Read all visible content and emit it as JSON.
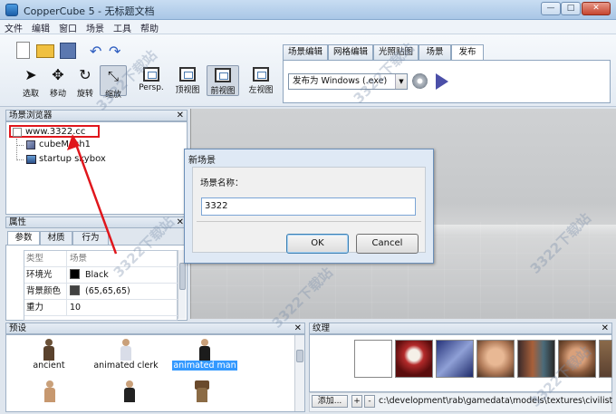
{
  "window": {
    "title": "CopperCube 5 - 无标题文档",
    "min": "—",
    "max": "□",
    "close": "✕"
  },
  "menu": [
    "文件",
    "编辑",
    "窗口",
    "场景",
    "工具",
    "帮助"
  ],
  "toolbar": {
    "tools": [
      {
        "id": "select",
        "label": "选取"
      },
      {
        "id": "move",
        "label": "移动"
      },
      {
        "id": "rotate",
        "label": "旋转"
      },
      {
        "id": "scale",
        "label": "缩放"
      },
      {
        "id": "persp",
        "label": "Persp."
      },
      {
        "id": "top",
        "label": "顶视图"
      },
      {
        "id": "front",
        "label": "前视图"
      },
      {
        "id": "left",
        "label": "左视图"
      }
    ],
    "tabs": [
      "场景编辑",
      "网格编辑",
      "光照贴图",
      "场景",
      "发布"
    ],
    "publish_select": "发布为 Windows (.exe)"
  },
  "scene_browser": {
    "title": "场景浏览器",
    "items": [
      {
        "label": "www.3322.cc"
      },
      {
        "label": "cubeMesh1"
      },
      {
        "label": "startup skybox"
      }
    ]
  },
  "properties": {
    "title": "属性",
    "tabs": [
      "参数",
      "材质",
      "行为"
    ],
    "rows": [
      {
        "key": "类型",
        "value": "场景"
      },
      {
        "key": "环境光",
        "value": "Black",
        "color": "#000000"
      },
      {
        "key": "背景颜色",
        "value": "(65,65,65)",
        "color": "#414141"
      },
      {
        "key": "重力",
        "value": "10"
      }
    ]
  },
  "dialog": {
    "title": "新场景",
    "label": "场景名称：",
    "input_value": "3322",
    "ok": "OK",
    "cancel": "Cancel"
  },
  "presets": {
    "title": "预设",
    "items": [
      {
        "label": "ancient"
      },
      {
        "label": "animated clerk"
      },
      {
        "label": "animated man",
        "selected": true
      }
    ]
  },
  "textures": {
    "title": "纹理",
    "add_button": "添加...",
    "plus": "+",
    "minus": "-",
    "path": "c:\\development\\rab\\gamedata\\models\\textures\\civilist"
  },
  "watermark": "3322下载站",
  "colors": {
    "accent": "#3399ff",
    "annotation": "#e0161c"
  }
}
